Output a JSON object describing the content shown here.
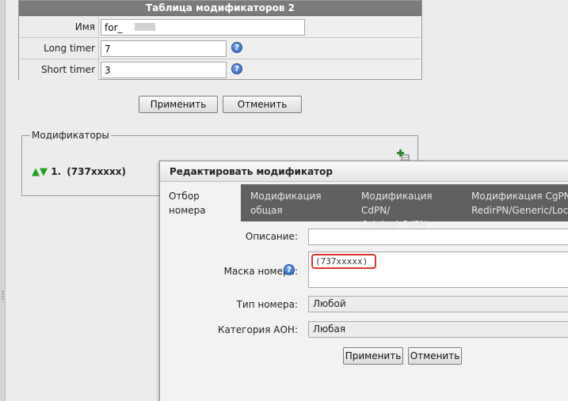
{
  "modifiers_table": {
    "title": "Таблица модификаторов 2",
    "name_label": "Имя",
    "name_value": "for_",
    "long_timer_label": "Long timer",
    "long_timer_value": "7",
    "short_timer_label": "Short timer",
    "short_timer_value": "3",
    "help_glyph": "?"
  },
  "actions": {
    "apply_label": "Применить",
    "cancel_label": "Отменить"
  },
  "modifiers": {
    "legend": "Модификаторы",
    "items": [
      {
        "index": "1.",
        "mask": "(737xxxxx)"
      }
    ]
  },
  "dialog": {
    "title": "Редактировать модификатор",
    "tabs": [
      {
        "line1": "Отбор номера",
        "line2": ""
      },
      {
        "line1": "Модификация общая",
        "line2": ""
      },
      {
        "line1": "Модификация CdPN/",
        "line2": "Original CdPN"
      },
      {
        "line1": "Модификация CgPN/",
        "line2": "RedirPN/Generic/Loca"
      }
    ],
    "description_label": "Описание:",
    "description_value": "",
    "mask_label": "Маска номера:",
    "mask_value": "(737xxxxx)",
    "number_type_label": "Тип номера:",
    "number_type_value": "Любой",
    "aon_category_label": "Категория АОН:",
    "aon_category_value": "Любая",
    "apply_label": "Применить",
    "cancel_label": "Отменить"
  },
  "colors": {
    "header_bg": "#7b7b7b",
    "tabs_bg": "#606060",
    "highlight": "#d9352b",
    "arrow_green": "#1ea11e",
    "help_blue": "#2a5db8"
  }
}
